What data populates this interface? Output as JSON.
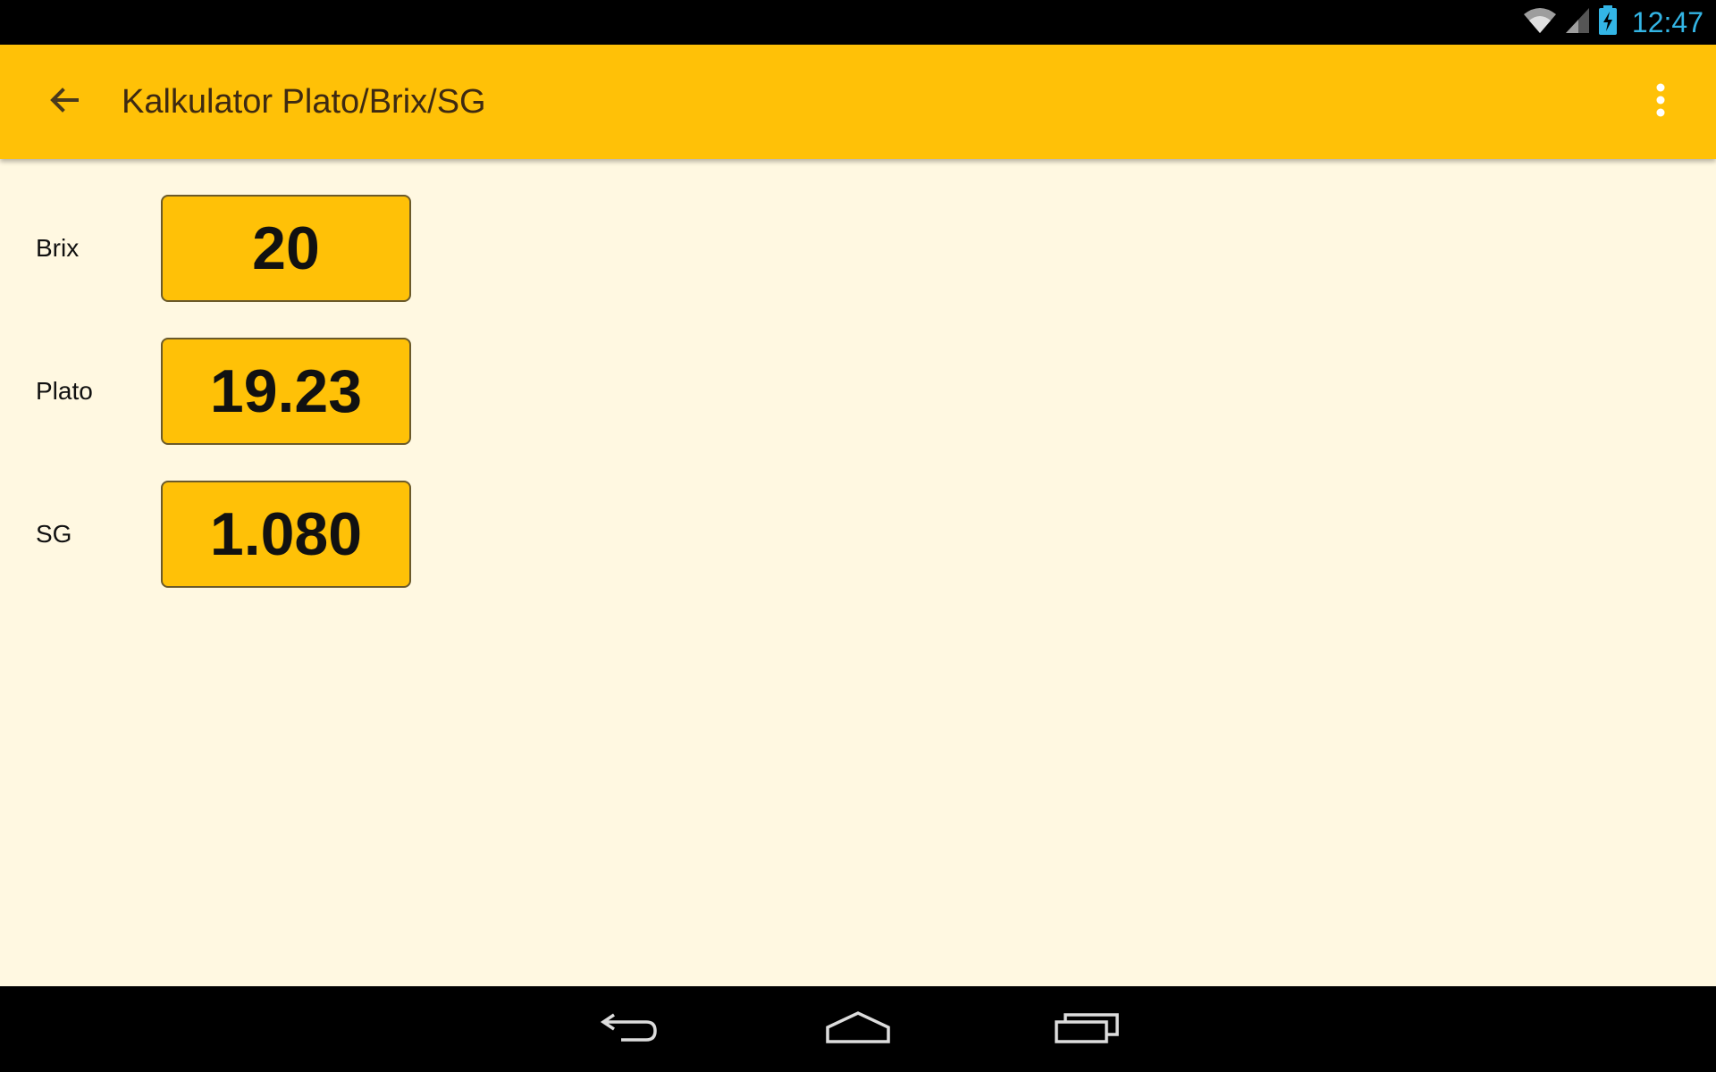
{
  "status_bar": {
    "time": "12:47",
    "icons": [
      "wifi-icon",
      "cell-signal-icon",
      "battery-charging-icon"
    ]
  },
  "app_bar": {
    "title": "Kalkulator Plato/Brix/SG",
    "back_icon": "arrow-back-icon",
    "overflow_icon": "more-vert-icon",
    "color": "#ffc107"
  },
  "fields": [
    {
      "label": "Brix",
      "value": "20"
    },
    {
      "label": "Plato",
      "value": "19.23"
    },
    {
      "label": "SG",
      "value": "1.080"
    }
  ],
  "nav_bar": {
    "icons": [
      "nav-back-icon",
      "nav-home-icon",
      "nav-recents-icon"
    ]
  },
  "colors": {
    "accent": "#ffc107",
    "background": "#fff8e1",
    "clock": "#33b5e5"
  }
}
